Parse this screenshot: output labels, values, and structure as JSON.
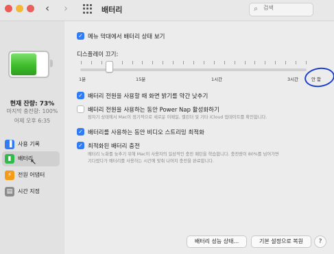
{
  "window": {
    "title": "배터리",
    "search_placeholder": "검색"
  },
  "sidebar": {
    "charge_level": "현재 잔량: 73%",
    "last_charged": "마지막 충전량: 100%",
    "charge_time": "어제 오후 6:35",
    "items": [
      {
        "label": "사용 기록",
        "color": "#2f7cf6"
      },
      {
        "label": "배터리",
        "color": "#33b94a"
      },
      {
        "label": "전원 어댑터",
        "color": "#f59b1a"
      },
      {
        "label": "시간 지정",
        "color": "#8c8c8c"
      }
    ]
  },
  "main": {
    "menu_status": {
      "label": "메뉴 막대에서 배터리 상태 보기",
      "checked": true
    },
    "display_off_label": "디스플레이 끄기:",
    "slider": {
      "value": "1분",
      "ticks": [
        "1분",
        "15분",
        "1시간",
        "3시간",
        "안 함"
      ]
    },
    "options": [
      {
        "label": "배터리 전원을 사용할 때 화면 밝기를 약간 낮추기",
        "checked": true,
        "desc": ""
      },
      {
        "label": "배터리 전원을 사용하는 동안 Power Nap 활성화하기",
        "checked": false,
        "desc": "잠자기 상태에서 Mac이 정기적으로 새로운 이메일, 캘린더 및 기타 iCloud 업데이트를 확인합니다."
      },
      {
        "label": "배터리를 사용하는 동안 비디오 스트리밍 최적화",
        "checked": true,
        "desc": ""
      },
      {
        "label": "최적화된 배터리 충전",
        "checked": true,
        "desc_line1": "배터리 노화를 늦추기 위해 Mac이 사용자의 일상적인 충전 패턴을 학습합니다. 충전량이 80%를 넘어가면",
        "desc_line2": "기다렸다가 배터리를 사용하는 시간에 맞춰 나머지 충전을 완료합니다."
      }
    ],
    "buttons": {
      "health": "배터리 성능 상태...",
      "restore": "기본 설정으로 복원",
      "help": "?"
    }
  }
}
